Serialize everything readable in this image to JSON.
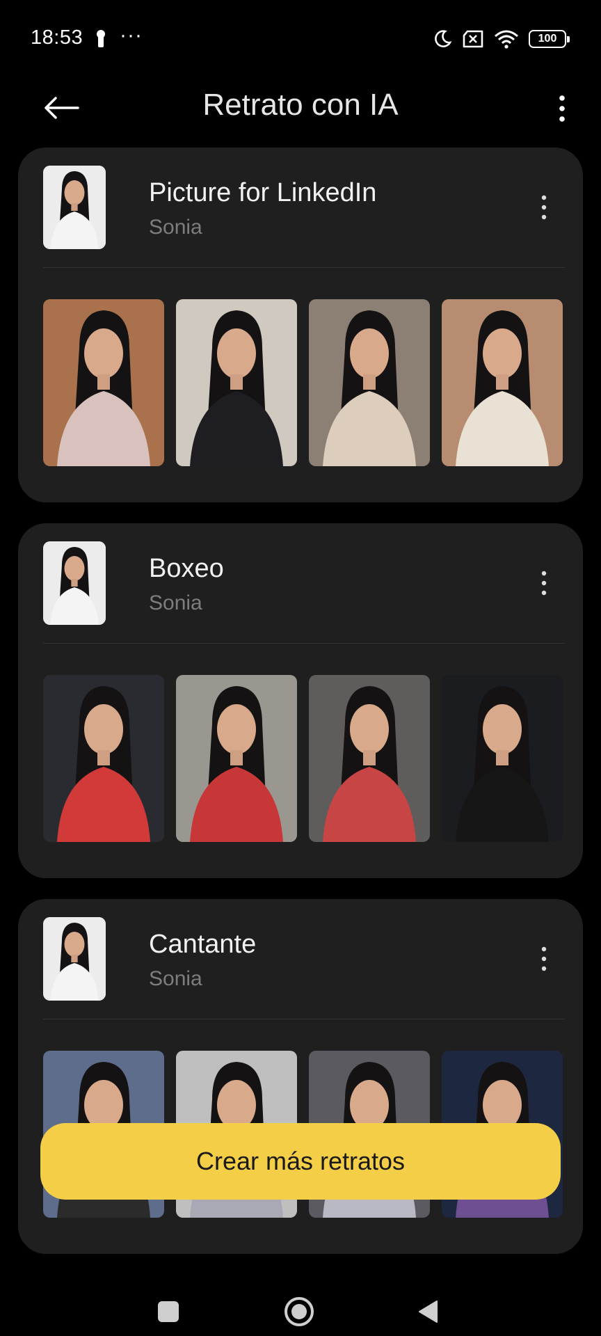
{
  "status_bar": {
    "time": "18:53",
    "dots": "···",
    "battery": "100",
    "icons": [
      "lock-icon",
      "moon-icon",
      "sim-off-icon",
      "wifi-icon",
      "battery-icon"
    ]
  },
  "header": {
    "title": "Retrato con IA",
    "back_icon": "arrow-left-icon",
    "menu_icon": "more-vertical-icon"
  },
  "albums": [
    {
      "title": "Picture for LinkedIn",
      "subtitle": "Sonia",
      "photos": [
        {
          "icon": "portrait-photo",
          "bg": "#a9724c",
          "outfit": "#d9c2bd"
        },
        {
          "icon": "portrait-photo",
          "bg": "#cfc9c0",
          "outfit": "#1d1d22"
        },
        {
          "icon": "portrait-photo",
          "bg": "#8c7f73",
          "outfit": "#dccdbc"
        },
        {
          "icon": "portrait-photo",
          "bg": "#b88c70",
          "outfit": "#e8e1d4"
        }
      ]
    },
    {
      "title": "Boxeo",
      "subtitle": "Sonia",
      "photos": [
        {
          "icon": "portrait-photo",
          "bg": "#2a2b30",
          "outfit": "#d23a3a"
        },
        {
          "icon": "portrait-photo",
          "bg": "#9a9690",
          "outfit": "#c83737"
        },
        {
          "icon": "portrait-photo",
          "bg": "#5f5d5b",
          "outfit": "#c84545"
        },
        {
          "icon": "portrait-photo",
          "bg": "#1b1c20",
          "outfit": "#161616"
        }
      ]
    },
    {
      "title": "Cantante",
      "subtitle": "Sonia",
      "photos": [
        {
          "icon": "portrait-photo",
          "bg": "#5f6d8c",
          "outfit": "#2b2b2b"
        },
        {
          "icon": "portrait-photo",
          "bg": "#bfbfbf",
          "outfit": "#a9a9b6"
        },
        {
          "icon": "portrait-photo",
          "bg": "#5a5a60",
          "outfit": "#b9b9c4"
        },
        {
          "icon": "portrait-photo",
          "bg": "#1e2740",
          "outfit": "#6e4f91"
        }
      ]
    }
  ],
  "cta": {
    "label": "Crear más retratos",
    "color": "#f4ce47"
  },
  "nav": {
    "icons": [
      "recents-icon",
      "home-icon",
      "back-triangle-icon"
    ]
  }
}
